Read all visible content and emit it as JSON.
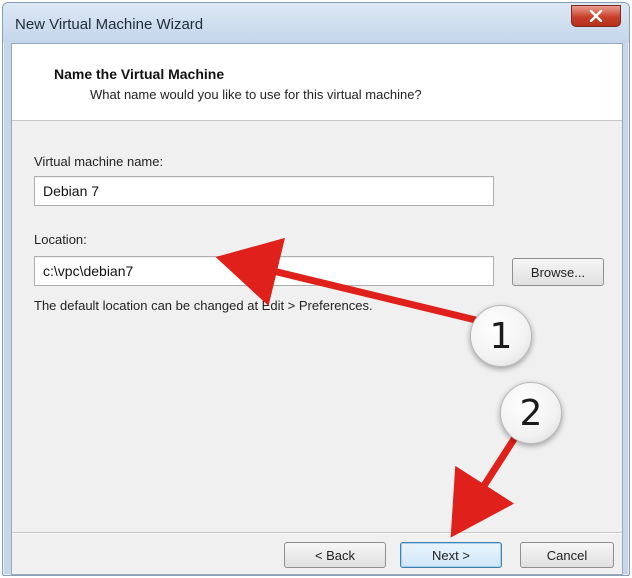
{
  "window": {
    "title": "New Virtual Machine Wizard",
    "close_icon": "close-icon"
  },
  "header": {
    "title": "Name the Virtual Machine",
    "subtitle": "What name would you like to use for this virtual machine?"
  },
  "form": {
    "name_label": "Virtual machine name:",
    "name_value": "Debian 7",
    "location_label": "Location:",
    "location_value": "c:\\vpc\\debian7",
    "browse_label": "Browse...",
    "hint": "The default location can be changed at Edit > Preferences."
  },
  "footer": {
    "back_label": "< Back",
    "next_label": "Next >",
    "cancel_label": "Cancel"
  },
  "annotations": {
    "callout_1": "1",
    "callout_2": "2",
    "arrow_color": "#e0201a"
  }
}
